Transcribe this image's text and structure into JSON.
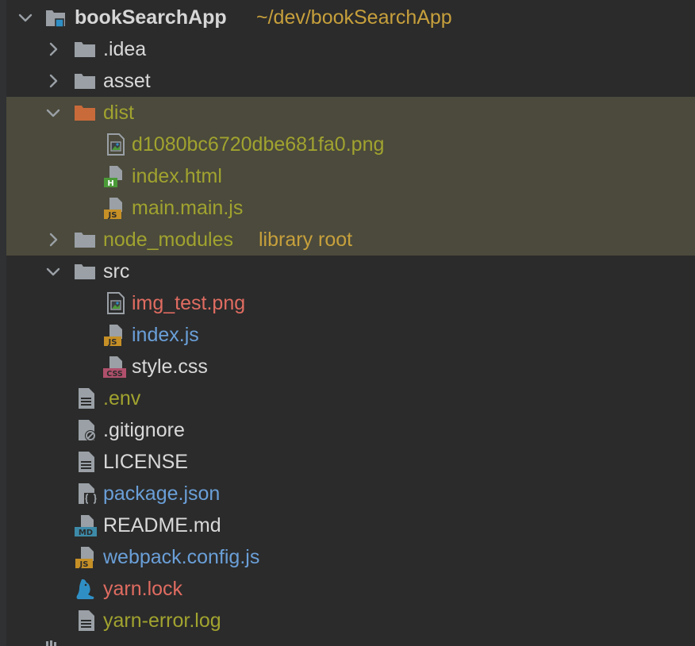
{
  "project_tree": {
    "root": {
      "name": "bookSearchApp",
      "path": "~/dev/bookSearchApp"
    },
    "rows": [
      {
        "label": ".idea",
        "kind": "folder",
        "expanded": false,
        "color": "#d9d9d9"
      },
      {
        "label": "asset",
        "kind": "folder",
        "expanded": false,
        "color": "#d9d9d9"
      },
      {
        "label": "dist",
        "kind": "folder-excluded",
        "expanded": true,
        "color": "#a1a32f"
      },
      {
        "label": "d1080bc6720dbe681fa0.png",
        "kind": "image-file",
        "color": "#a1a32f"
      },
      {
        "label": "index.html",
        "kind": "html-file",
        "badge": "H",
        "color": "#a1a32f"
      },
      {
        "label": "main.main.js",
        "kind": "js-file",
        "badge": "JS",
        "color": "#a1a32f"
      },
      {
        "label": "node_modules",
        "suffix": "library root",
        "kind": "folder",
        "expanded": false,
        "color": "#a1a32f"
      },
      {
        "label": "src",
        "kind": "folder",
        "expanded": true,
        "color": "#d9d9d9"
      },
      {
        "label": "img_test.png",
        "kind": "image-file",
        "color": "#e06c61"
      },
      {
        "label": "index.js",
        "kind": "js-file",
        "badge": "JS",
        "color": "#6a9fd8"
      },
      {
        "label": "style.css",
        "kind": "css-file",
        "badge": "CSS",
        "color": "#d9d9d9"
      },
      {
        "label": ".env",
        "kind": "text-file",
        "color": "#a1a32f"
      },
      {
        "label": ".gitignore",
        "kind": "ignore-file",
        "color": "#d9d9d9"
      },
      {
        "label": "LICENSE",
        "kind": "text-file",
        "color": "#d9d9d9"
      },
      {
        "label": "package.json",
        "kind": "json-file",
        "color": "#6a9fd8"
      },
      {
        "label": "README.md",
        "kind": "md-file",
        "badge": "MD",
        "color": "#d9d9d9"
      },
      {
        "label": "webpack.config.js",
        "kind": "js-file",
        "badge": "JS",
        "color": "#6a9fd8"
      },
      {
        "label": "yarn.lock",
        "kind": "yarn-file",
        "color": "#e06c61"
      },
      {
        "label": "yarn-error.log",
        "kind": "text-file",
        "color": "#a1a32f"
      }
    ],
    "colors": {
      "background": "#2b2b2b",
      "highlight_band": "#4b4a3c",
      "folder_gray": "#9aa0a6",
      "excluded_folder": "#c96a3a",
      "js_badge": "#c69026",
      "html_badge": "#4b9a38",
      "css_badge": "#b0506c",
      "md_badge": "#3d8aa8",
      "yarn_blue": "#2f8fc5"
    }
  }
}
